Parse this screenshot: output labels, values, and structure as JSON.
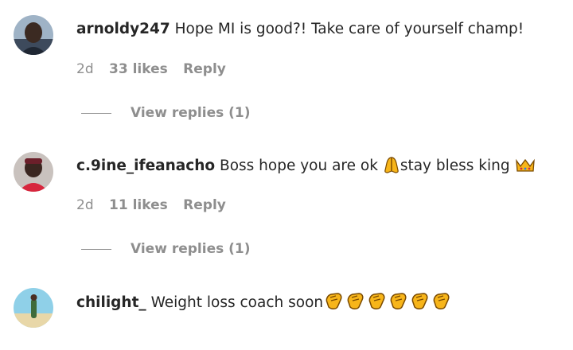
{
  "comments": [
    {
      "username": "arnoldy247",
      "text": "Hope MI is good?! Take care of yourself champ!",
      "time": "2d",
      "likes": "33 likes",
      "reply": "Reply",
      "view_replies": "View replies (1)"
    },
    {
      "username": "c.9ine_ifeanacho",
      "text_a": "Boss hope you are ok ",
      "text_b": "stay bless king ",
      "time": "2d",
      "likes": "11 likes",
      "reply": "Reply",
      "view_replies": "View replies (1)",
      "emojis": [
        "praying-hands-icon",
        "crown-icon"
      ]
    },
    {
      "username": "chilight_",
      "text": "Weight loss coach soon",
      "emojis": [
        "clapping-hands-icon",
        "clapping-hands-icon",
        "clapping-hands-icon",
        "clapping-hands-icon",
        "clapping-hands-icon",
        "clapping-hands-icon"
      ]
    }
  ],
  "colors": {
    "text": "#262626",
    "muted": "#8e8e8e",
    "emoji_yellow": "#f7b51a"
  }
}
